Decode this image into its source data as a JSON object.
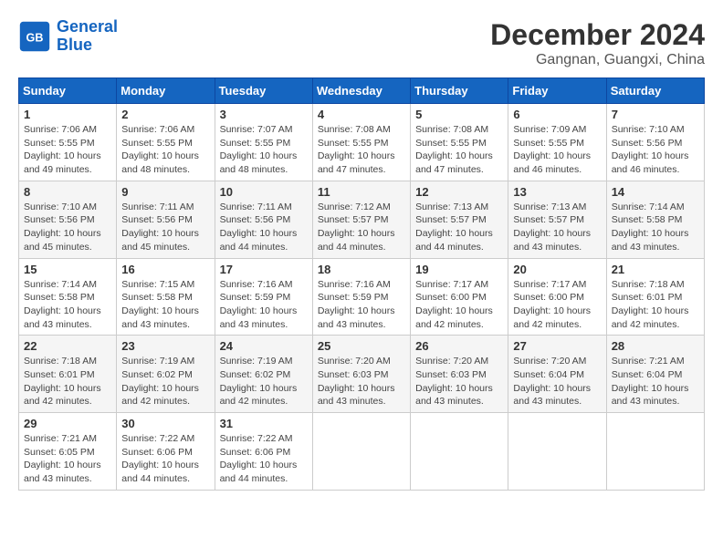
{
  "header": {
    "logo_line1": "General",
    "logo_line2": "Blue",
    "month_year": "December 2024",
    "location": "Gangnan, Guangxi, China"
  },
  "weekdays": [
    "Sunday",
    "Monday",
    "Tuesday",
    "Wednesday",
    "Thursday",
    "Friday",
    "Saturday"
  ],
  "weeks": [
    [
      {
        "day": "1",
        "sunrise": "7:06 AM",
        "sunset": "5:55 PM",
        "daylight": "10 hours and 49 minutes."
      },
      {
        "day": "2",
        "sunrise": "7:06 AM",
        "sunset": "5:55 PM",
        "daylight": "10 hours and 48 minutes."
      },
      {
        "day": "3",
        "sunrise": "7:07 AM",
        "sunset": "5:55 PM",
        "daylight": "10 hours and 48 minutes."
      },
      {
        "day": "4",
        "sunrise": "7:08 AM",
        "sunset": "5:55 PM",
        "daylight": "10 hours and 47 minutes."
      },
      {
        "day": "5",
        "sunrise": "7:08 AM",
        "sunset": "5:55 PM",
        "daylight": "10 hours and 47 minutes."
      },
      {
        "day": "6",
        "sunrise": "7:09 AM",
        "sunset": "5:55 PM",
        "daylight": "10 hours and 46 minutes."
      },
      {
        "day": "7",
        "sunrise": "7:10 AM",
        "sunset": "5:56 PM",
        "daylight": "10 hours and 46 minutes."
      }
    ],
    [
      {
        "day": "8",
        "sunrise": "7:10 AM",
        "sunset": "5:56 PM",
        "daylight": "10 hours and 45 minutes."
      },
      {
        "day": "9",
        "sunrise": "7:11 AM",
        "sunset": "5:56 PM",
        "daylight": "10 hours and 45 minutes."
      },
      {
        "day": "10",
        "sunrise": "7:11 AM",
        "sunset": "5:56 PM",
        "daylight": "10 hours and 44 minutes."
      },
      {
        "day": "11",
        "sunrise": "7:12 AM",
        "sunset": "5:57 PM",
        "daylight": "10 hours and 44 minutes."
      },
      {
        "day": "12",
        "sunrise": "7:13 AM",
        "sunset": "5:57 PM",
        "daylight": "10 hours and 44 minutes."
      },
      {
        "day": "13",
        "sunrise": "7:13 AM",
        "sunset": "5:57 PM",
        "daylight": "10 hours and 43 minutes."
      },
      {
        "day": "14",
        "sunrise": "7:14 AM",
        "sunset": "5:58 PM",
        "daylight": "10 hours and 43 minutes."
      }
    ],
    [
      {
        "day": "15",
        "sunrise": "7:14 AM",
        "sunset": "5:58 PM",
        "daylight": "10 hours and 43 minutes."
      },
      {
        "day": "16",
        "sunrise": "7:15 AM",
        "sunset": "5:58 PM",
        "daylight": "10 hours and 43 minutes."
      },
      {
        "day": "17",
        "sunrise": "7:16 AM",
        "sunset": "5:59 PM",
        "daylight": "10 hours and 43 minutes."
      },
      {
        "day": "18",
        "sunrise": "7:16 AM",
        "sunset": "5:59 PM",
        "daylight": "10 hours and 43 minutes."
      },
      {
        "day": "19",
        "sunrise": "7:17 AM",
        "sunset": "6:00 PM",
        "daylight": "10 hours and 42 minutes."
      },
      {
        "day": "20",
        "sunrise": "7:17 AM",
        "sunset": "6:00 PM",
        "daylight": "10 hours and 42 minutes."
      },
      {
        "day": "21",
        "sunrise": "7:18 AM",
        "sunset": "6:01 PM",
        "daylight": "10 hours and 42 minutes."
      }
    ],
    [
      {
        "day": "22",
        "sunrise": "7:18 AM",
        "sunset": "6:01 PM",
        "daylight": "10 hours and 42 minutes."
      },
      {
        "day": "23",
        "sunrise": "7:19 AM",
        "sunset": "6:02 PM",
        "daylight": "10 hours and 42 minutes."
      },
      {
        "day": "24",
        "sunrise": "7:19 AM",
        "sunset": "6:02 PM",
        "daylight": "10 hours and 42 minutes."
      },
      {
        "day": "25",
        "sunrise": "7:20 AM",
        "sunset": "6:03 PM",
        "daylight": "10 hours and 43 minutes."
      },
      {
        "day": "26",
        "sunrise": "7:20 AM",
        "sunset": "6:03 PM",
        "daylight": "10 hours and 43 minutes."
      },
      {
        "day": "27",
        "sunrise": "7:20 AM",
        "sunset": "6:04 PM",
        "daylight": "10 hours and 43 minutes."
      },
      {
        "day": "28",
        "sunrise": "7:21 AM",
        "sunset": "6:04 PM",
        "daylight": "10 hours and 43 minutes."
      }
    ],
    [
      {
        "day": "29",
        "sunrise": "7:21 AM",
        "sunset": "6:05 PM",
        "daylight": "10 hours and 43 minutes."
      },
      {
        "day": "30",
        "sunrise": "7:22 AM",
        "sunset": "6:06 PM",
        "daylight": "10 hours and 44 minutes."
      },
      {
        "day": "31",
        "sunrise": "7:22 AM",
        "sunset": "6:06 PM",
        "daylight": "10 hours and 44 minutes."
      },
      null,
      null,
      null,
      null
    ]
  ]
}
